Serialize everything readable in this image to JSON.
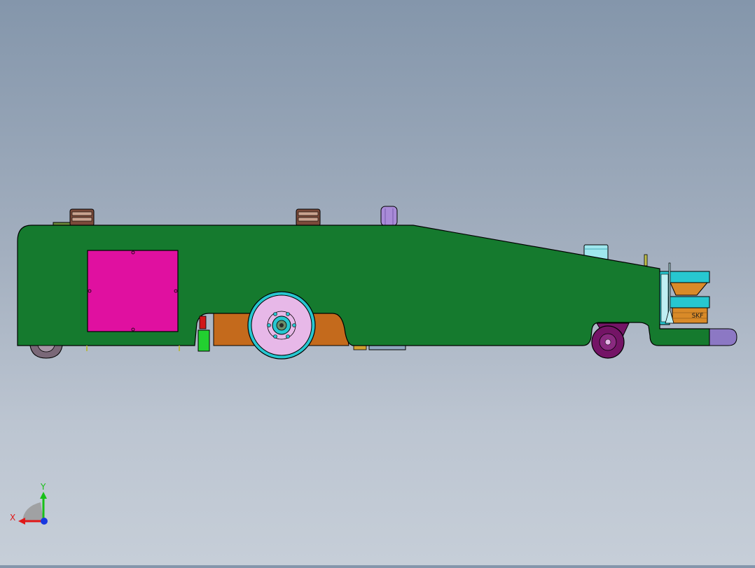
{
  "viewport": {
    "background_top": "#8496ab",
    "background_bottom": "#c6ced8"
  },
  "model": {
    "body_color": "#157a2e",
    "panel_color": "#e010a0",
    "drive_wheel_color": "#e7b8e8",
    "caster_color": "#741466",
    "lift_plate_color": "#8c78c4",
    "hub_color": "#27c7d0",
    "skirt_color": "#c46a1c",
    "bearing_label": "SKF"
  },
  "triad": {
    "x_label": "X",
    "y_label": "Y",
    "x_color": "#e01818",
    "y_color": "#18c018",
    "z_color": "#1838e0"
  }
}
